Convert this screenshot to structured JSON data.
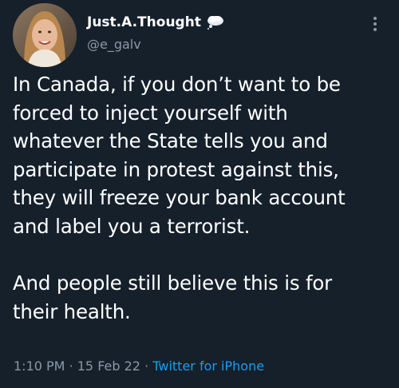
{
  "tweet": {
    "display_name": "Just.A.Thought",
    "handle": "@e_galv",
    "badge_icon": "thought-bubble-icon",
    "more_icon": "more-options-icon",
    "paragraph_1": "In Canada, if you don’t want to be\nforced to inject yourself with\nwhatever the State tells you and\nparticipate in protest against this,\nthey will freeze your bank account\nand label you a terrorist.",
    "paragraph_2": "And people still believe this is for\ntheir health.",
    "time": "1:10 PM",
    "separator": "·",
    "date": "15 Feb 22",
    "source": "Twitter for iPhone"
  },
  "colors": {
    "background": "#15202b",
    "text": "#ffffff",
    "secondary": "#8b98a5",
    "link": "#1d9bf0"
  }
}
